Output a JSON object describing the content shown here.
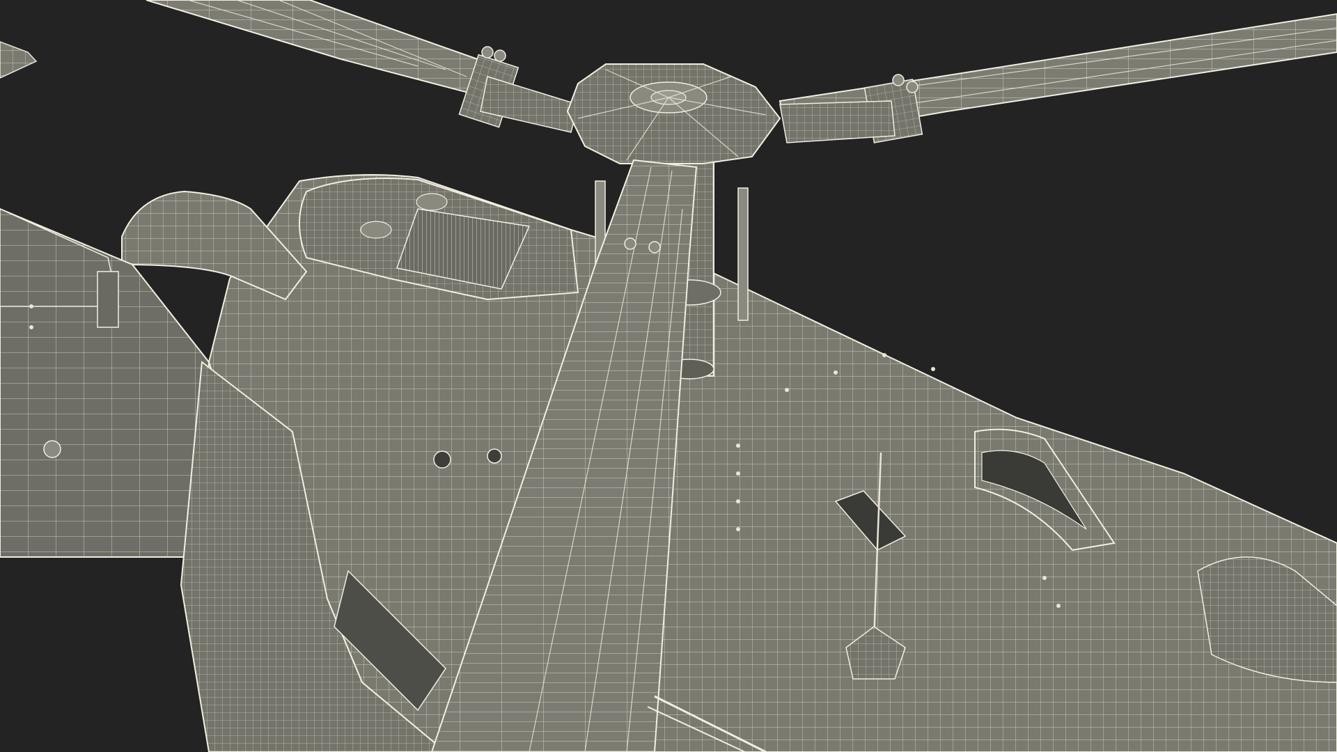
{
  "scene": {
    "subject": "helicopter-wireframe-render",
    "colors": {
      "background": "#232323",
      "mesh_fill": "#7a7a70",
      "wire": "#e9e6d8"
    }
  }
}
